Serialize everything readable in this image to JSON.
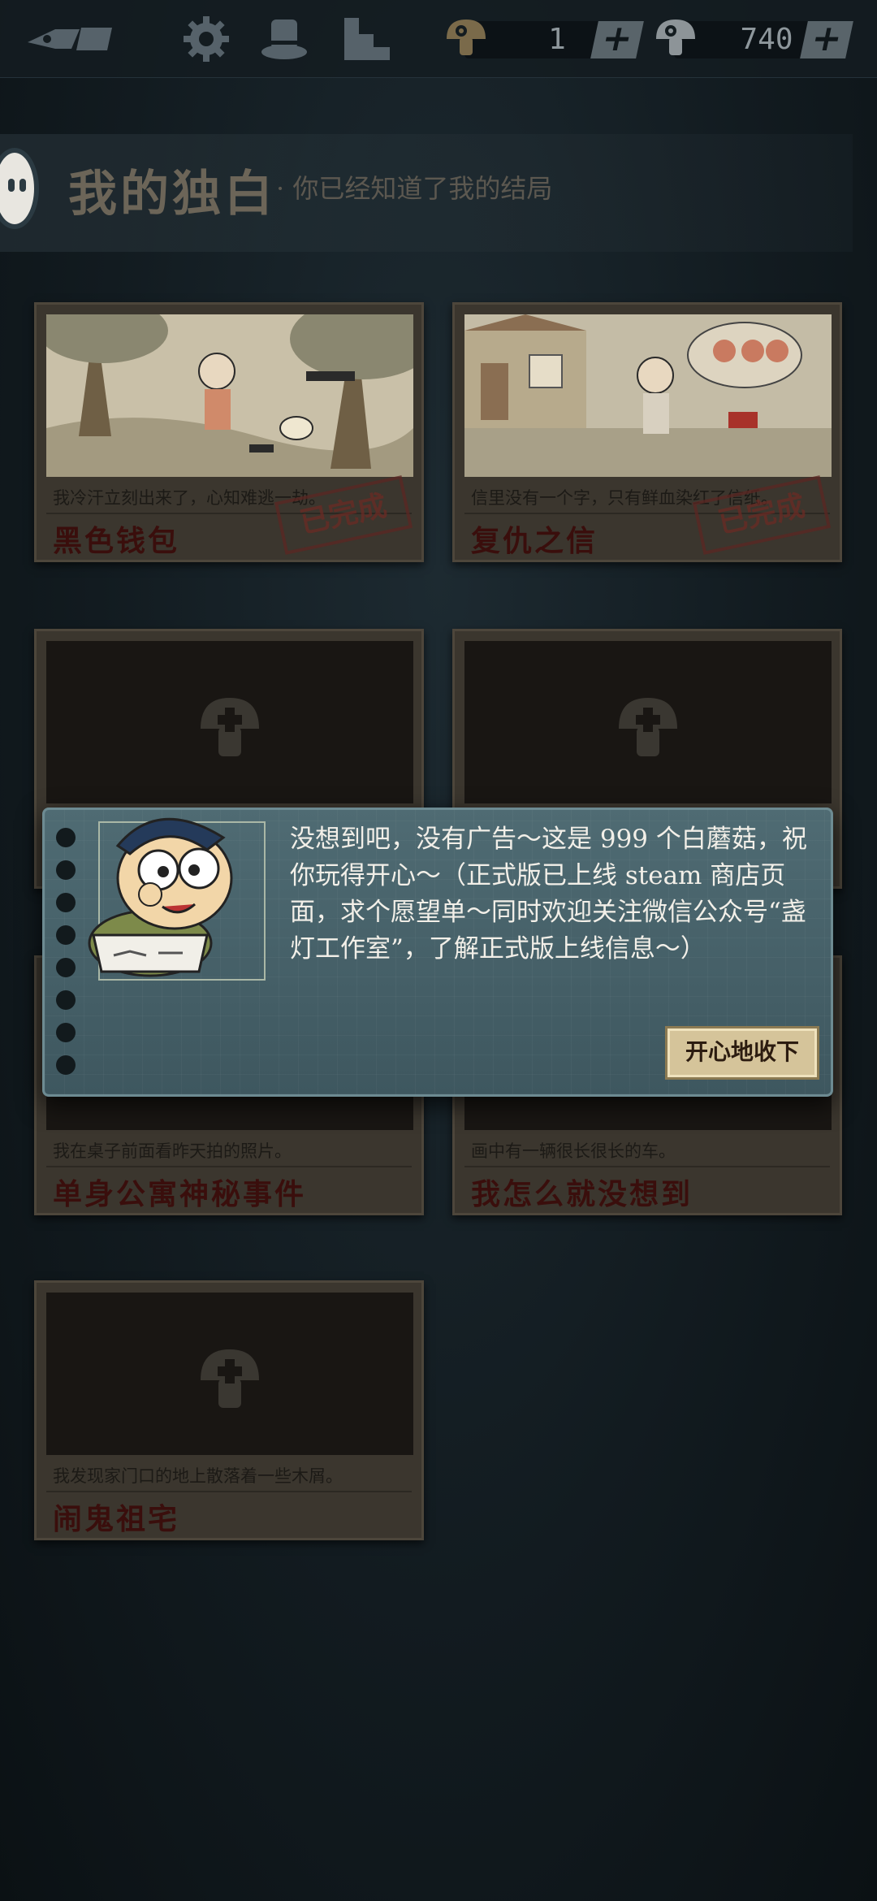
{
  "topbar": {
    "currency_a": {
      "value": "1"
    },
    "currency_b": {
      "value": "740"
    },
    "plus_label": "+"
  },
  "header": {
    "title": "我的独白",
    "subtitle": "· 你已经知道了我的结局"
  },
  "cards": [
    {
      "name": "黑色钱包",
      "desc": "我冷汗立刻出来了，心知难逃一劫。",
      "status": "已完成",
      "unlocked": true
    },
    {
      "name": "复仇之信",
      "desc": "信里没有一个字，只有鲜血染红了信纸。",
      "status": "已完成",
      "unlocked": true
    },
    {
      "name": "",
      "desc": "",
      "unlocked": false
    },
    {
      "name": "",
      "desc": "",
      "unlocked": false
    },
    {
      "name": "单身公寓神秘事件",
      "desc": "我在桌子前面看昨天拍的照片。",
      "unlocked": false
    },
    {
      "name": "我怎么就没想到",
      "desc": "画中有一辆很长很长的车。",
      "unlocked": false
    },
    {
      "name": "闹鬼祖宅",
      "desc": "我发现家门口的地上散落着一些木屑。",
      "unlocked": false
    }
  ],
  "dialog": {
    "message": "没想到吧，没有广告～这是 999 个白蘑菇，祝你玩得开心～（正式版已上线 steam 商店页面，求个愿望单～同时欢迎关注微信公众号“盏灯工作室”，了解正式版上线信息～）",
    "button": "开心地收下"
  },
  "colors": {
    "background": "#121b20",
    "card": "#3b362e",
    "dialog": "#4f6b73",
    "title_red": "#3a0e0c"
  }
}
